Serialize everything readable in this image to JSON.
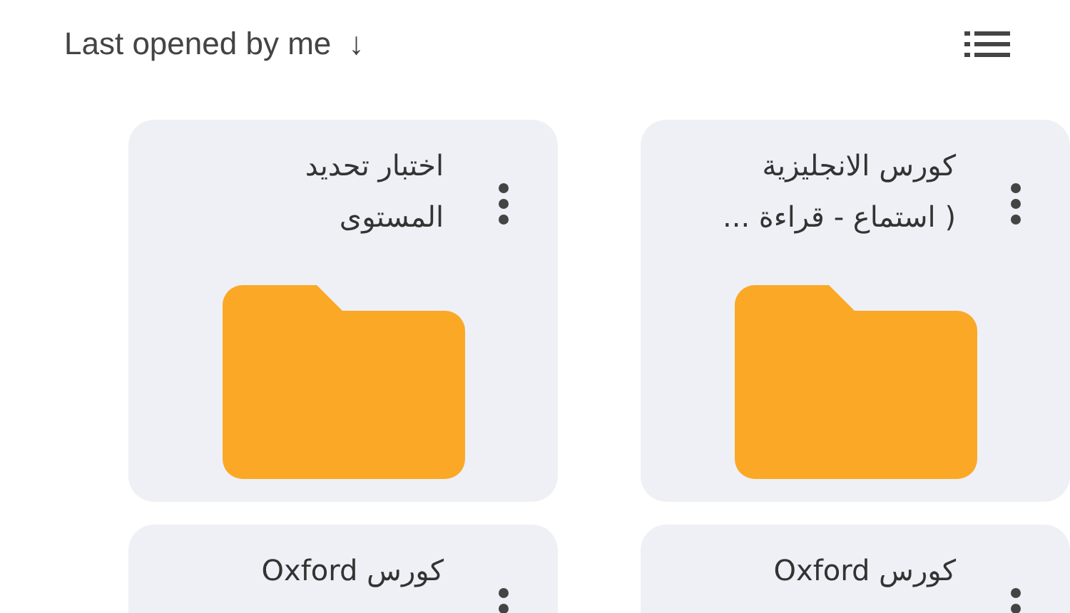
{
  "sort": {
    "label": "Last opened by me",
    "arrow": "↓"
  },
  "folders": [
    {
      "title_lines": [
        "كورس الانجليزية",
        "( استماع - قراءة ..."
      ]
    },
    {
      "title_lines": [
        "اختبار تحديد",
        "المستوى"
      ]
    },
    {
      "title_lines": [
        "كورس Oxford"
      ]
    },
    {
      "title_lines": [
        "كورس Oxford"
      ]
    }
  ]
}
